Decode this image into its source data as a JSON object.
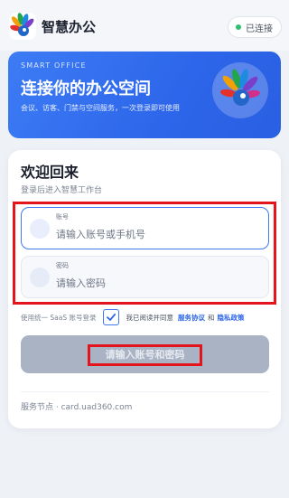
{
  "header": {
    "app_title": "智慧办公",
    "status": "已连接",
    "logo_icon": "peacock-logo-icon"
  },
  "hero": {
    "eyebrow": "SMART OFFICE",
    "title": "连接你的办公空间",
    "subtitle": "会议、访客、门禁与空间服务，一次登录即可使用"
  },
  "login": {
    "welcome": "欢迎回来",
    "subtitle": "登录后进入智慧工作台",
    "account": {
      "label": "账号",
      "placeholder": "请输入账号或手机号",
      "value": ""
    },
    "password": {
      "label": "密码",
      "placeholder": "请输入密码",
      "value": ""
    },
    "sso_hint": "使用统一 SaaS 账号登录",
    "agree_text": "我已阅读并同意",
    "service_agreement": "服务协议",
    "and": "和",
    "privacy_policy": "隐私政策",
    "agreement_checked": true,
    "submit_label": "请输入账号和密码",
    "node_text": "服务节点 · card.uad360.com"
  },
  "colors": {
    "accent": "#2d66ea",
    "status_dot": "#2fbf71",
    "highlight": "#e3141c",
    "submit_disabled": "#a9b3c4"
  }
}
